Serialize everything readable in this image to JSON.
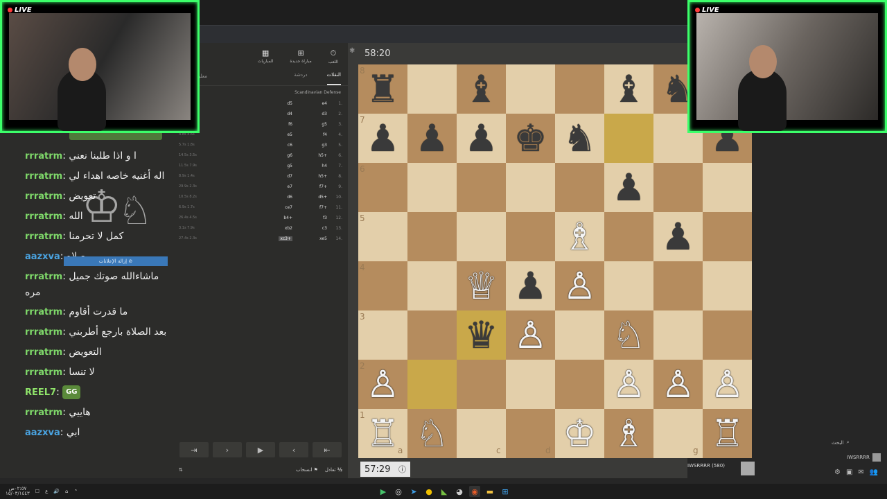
{
  "live_label": "LIVE",
  "timers": {
    "top": "58:20",
    "bottom": "57:29"
  },
  "panel": {
    "tabs": [
      "اللعب",
      "مباراة جديدة",
      "المباريات"
    ],
    "tab_cut": "معلو",
    "subtabs": [
      "النقلات",
      "دردشة"
    ],
    "opening": "Scandinavian Defense",
    "moves": [
      {
        "n": "1.",
        "w": "e4",
        "b": "d5",
        "t": ""
      },
      {
        "n": "2.",
        "w": "d3",
        "b": "d4",
        "t": ""
      },
      {
        "n": "3.",
        "w": "g5",
        "b": "f6",
        "t": "6.4s\n4.5s"
      },
      {
        "n": "4.",
        "w": "f4",
        "b": "e5",
        "t": "4.8s\n4.6s"
      },
      {
        "n": "5.",
        "w": "g3",
        "b": "c6",
        "t": "5.7s\n1.8s"
      },
      {
        "n": "6.",
        "w": "h5+",
        "b": "g6",
        "t": "14.5s\n3.5s"
      },
      {
        "n": "7.",
        "w": "h4",
        "b": "g5",
        "t": "11.5s\n7.9s"
      },
      {
        "n": "8.",
        "w": "h5+",
        "b": "d7",
        "t": "8.9s\n1.4s"
      },
      {
        "n": "9.",
        "w": "f7+",
        "b": "e7",
        "t": "29.9s\n2.3s"
      },
      {
        "n": "10.",
        "w": "d5+",
        "b": "d6",
        "t": "10.5s\n8.2s"
      },
      {
        "n": "11.",
        "w": "f7+",
        "b": "ce7",
        "t": "6.9s\n1.7s"
      },
      {
        "n": "12.",
        "w": "f3",
        "b": "b4+",
        "t": "26.4s\n4.5s"
      },
      {
        "n": "13.",
        "w": "c3",
        "b": "xb2",
        "t": "3.1s\n7.9s"
      },
      {
        "n": "14.",
        "w": "xe5",
        "b": "xc3+",
        "t": "27.4s\n2.3s"
      }
    ],
    "nav": [
      "⇤",
      "‹",
      "▶",
      "›",
      "⇥"
    ],
    "foot_draw": "تعادل",
    "foot_resign": "انسحاب",
    "foot_half": "½"
  },
  "chat": {
    "messages": [
      {
        "user": "rrratrm",
        "text": "ا و اذا طلبنا نعني",
        "cls": "u-green"
      },
      {
        "user": "rrratrm",
        "text": "اله أغنيه خاصه اهداء لي",
        "cls": "u-green"
      },
      {
        "user": "rrratrm",
        "text": "تعويض",
        "cls": "u-green"
      },
      {
        "user": "rrratrm",
        "text": "الله",
        "cls": "u-green"
      },
      {
        "user": "rrratrm",
        "text": "كمل لا تحرمنا",
        "cls": "u-green"
      },
      {
        "user": "aazxva",
        "text": "صلاه",
        "cls": "u-blue"
      },
      {
        "user": "rrratrm",
        "text": "ماشاءالله صوتك جميل مره",
        "cls": "u-green"
      },
      {
        "user": "rrratrm",
        "text": "ما قدرت أقاوم",
        "cls": "u-green"
      },
      {
        "user": "rrratrm",
        "text": "بعد الصلاة بارجع أطربني",
        "cls": "u-green"
      },
      {
        "user": "rrratrm",
        "text": "التعويض",
        "cls": "u-green"
      },
      {
        "user": "rrratrm",
        "text": "لا تنسا",
        "cls": "u-green"
      },
      {
        "user": "REEL7",
        "text": "GG",
        "cls": "u-lime",
        "emote": true
      },
      {
        "user": "rrratrm",
        "text": "هاييي",
        "cls": "u-green"
      },
      {
        "user": "aazxva",
        "text": "ابي",
        "cls": "u-blue"
      }
    ],
    "remove_ads": "إزالة الإعلانات ⊘"
  },
  "board": {
    "files": [
      "a",
      "b",
      "c",
      "d",
      "e",
      "f",
      "g",
      "h"
    ],
    "highlights": [
      {
        "sq": "f7",
        "cls": "hl"
      },
      {
        "sq": "c3",
        "cls": "hl"
      },
      {
        "sq": "b2",
        "cls": "hl"
      }
    ],
    "pieces": [
      {
        "sq": "a8",
        "p": "♜",
        "c": "black"
      },
      {
        "sq": "c8",
        "p": "♝",
        "c": "black"
      },
      {
        "sq": "f8",
        "p": "♝",
        "c": "black"
      },
      {
        "sq": "g8",
        "p": "♞",
        "c": "black"
      },
      {
        "sq": "a7",
        "p": "♟",
        "c": "black"
      },
      {
        "sq": "b7",
        "p": "♟",
        "c": "black"
      },
      {
        "sq": "c7",
        "p": "♟",
        "c": "black"
      },
      {
        "sq": "d7",
        "p": "♚",
        "c": "black"
      },
      {
        "sq": "e7",
        "p": "♞",
        "c": "black"
      },
      {
        "sq": "h7",
        "p": "♟",
        "c": "black"
      },
      {
        "sq": "f6",
        "p": "♟",
        "c": "black"
      },
      {
        "sq": "e5",
        "p": "♗",
        "c": "white"
      },
      {
        "sq": "g5",
        "p": "♟",
        "c": "black"
      },
      {
        "sq": "c4",
        "p": "♕",
        "c": "white"
      },
      {
        "sq": "d4",
        "p": "♟",
        "c": "black"
      },
      {
        "sq": "e4",
        "p": "♙",
        "c": "white"
      },
      {
        "sq": "c3",
        "p": "♛",
        "c": "black"
      },
      {
        "sq": "d3",
        "p": "♙",
        "c": "white"
      },
      {
        "sq": "f3",
        "p": "♘",
        "c": "white"
      },
      {
        "sq": "a2",
        "p": "♙",
        "c": "white"
      },
      {
        "sq": "f2",
        "p": "♙",
        "c": "white"
      },
      {
        "sq": "g2",
        "p": "♙",
        "c": "white"
      },
      {
        "sq": "h2",
        "p": "♙",
        "c": "white"
      },
      {
        "sq": "a1",
        "p": "♖",
        "c": "white"
      },
      {
        "sq": "b1",
        "p": "♘",
        "c": "white"
      },
      {
        "sq": "e1",
        "p": "♔",
        "c": "white"
      },
      {
        "sq": "f1",
        "p": "♗",
        "c": "white"
      },
      {
        "sq": "h1",
        "p": "♖",
        "c": "white"
      }
    ],
    "rank_labels": [
      "8",
      "7",
      "6",
      "5",
      "4",
      "3",
      "2",
      "1"
    ],
    "file_labels_visible": [
      "a",
      "c",
      "d",
      "g"
    ]
  },
  "player_bottom": "IWSRRRR (580)",
  "sidebar": {
    "search": "البحث",
    "username": "IWSRRRR"
  },
  "taskbar": {
    "clock": "٠٢:٥٧ص",
    "date": "١٥/٠٣/١٤٤٣"
  }
}
